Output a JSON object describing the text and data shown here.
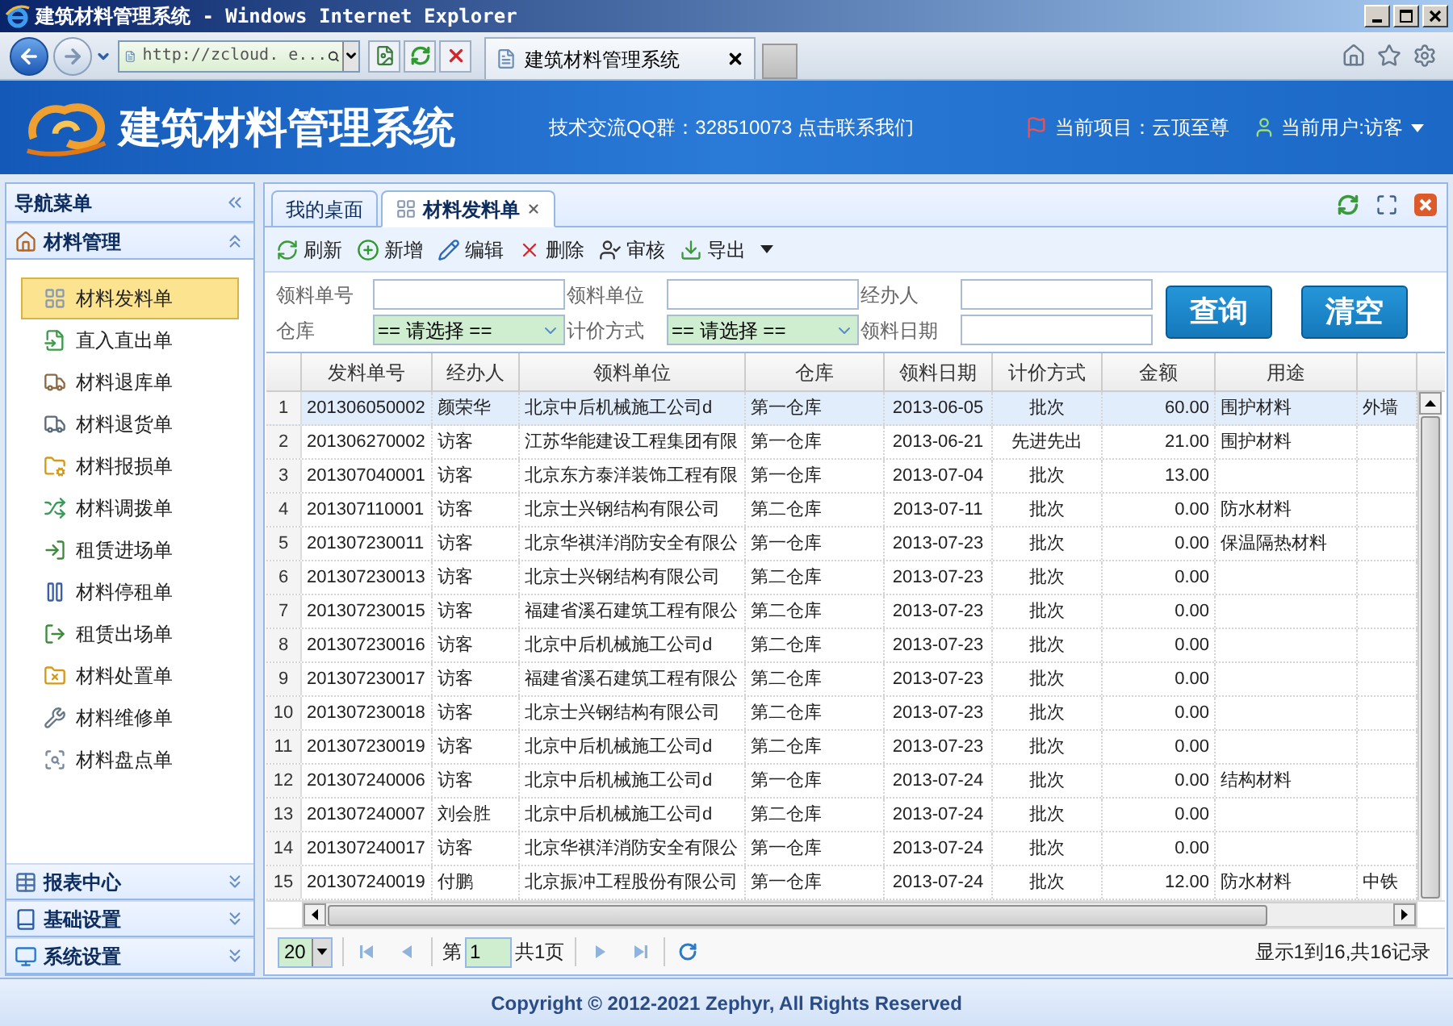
{
  "window": {
    "title": "建筑材料管理系统 - Windows Internet Explorer"
  },
  "browser": {
    "address": "http://zcloud. e...",
    "tab_title": "建筑材料管理系统"
  },
  "header": {
    "title": "建筑材料管理系统",
    "contact": "技术交流QQ群：328510073 点击联系我们",
    "project": "当前项目：云顶至尊",
    "user": "当前用户:访客"
  },
  "sidebar": {
    "title": "导航菜单",
    "sections": [
      {
        "label": "材料管理",
        "expanded": true,
        "items": [
          {
            "label": "材料发料单",
            "selected": true
          },
          {
            "label": "直入直出单",
            "selected": false
          },
          {
            "label": "材料退库单",
            "selected": false
          },
          {
            "label": "材料退货单",
            "selected": false
          },
          {
            "label": "材料报损单",
            "selected": false
          },
          {
            "label": "材料调拨单",
            "selected": false
          },
          {
            "label": "租赁进场单",
            "selected": false
          },
          {
            "label": "材料停租单",
            "selected": false
          },
          {
            "label": "租赁出场单",
            "selected": false
          },
          {
            "label": "材料处置单",
            "selected": false
          },
          {
            "label": "材料维修单",
            "selected": false
          },
          {
            "label": "材料盘点单",
            "selected": false
          }
        ]
      },
      {
        "label": "报表中心",
        "expanded": false
      },
      {
        "label": "基础设置",
        "expanded": false
      },
      {
        "label": "系统设置",
        "expanded": false
      }
    ]
  },
  "tabs": [
    {
      "label": "我的桌面",
      "selected": false,
      "closable": false
    },
    {
      "label": "材料发料单",
      "selected": true,
      "closable": true
    }
  ],
  "toolbar": [
    {
      "label": "刷新",
      "dropdown": false
    },
    {
      "label": "新增",
      "dropdown": false
    },
    {
      "label": "编辑",
      "dropdown": false
    },
    {
      "label": "删除",
      "dropdown": false
    },
    {
      "label": "审核",
      "dropdown": false
    },
    {
      "label": "导出",
      "dropdown": true
    }
  ],
  "search": {
    "fields": [
      {
        "label": "领料单号",
        "kind": "text"
      },
      {
        "label": "领料单位",
        "kind": "text"
      },
      {
        "label": "经办人",
        "kind": "text"
      },
      {
        "label": "仓库",
        "kind": "select",
        "value": "== 请选择 =="
      },
      {
        "label": "计价方式",
        "kind": "select",
        "value": "== 请选择 =="
      },
      {
        "label": "领料日期",
        "kind": "text"
      }
    ],
    "buttons": [
      "查询",
      "清空"
    ]
  },
  "table": {
    "columns": [
      "发料单号",
      "经办人",
      "领料单位",
      "仓库",
      "领料日期",
      "计价方式",
      "金额",
      "用途"
    ],
    "rows": [
      {
        "no": "1",
        "selected": true,
        "order_no": "201306050002",
        "handler": "颜荣华",
        "unit": "北京中后机械施工公司d",
        "warehouse": "第一仓库",
        "date": "2013-06-05",
        "pricing": "批次",
        "amount": "60.00",
        "purpose": "围护材料",
        "column_10": "外墙"
      },
      {
        "no": "2",
        "selected": false,
        "order_no": "201306270002",
        "handler": "访客",
        "unit": "江苏华能建设工程集团有限",
        "warehouse": "第一仓库",
        "date": "2013-06-21",
        "pricing": "先进先出",
        "amount": "21.00",
        "purpose": "围护材料"
      },
      {
        "no": "3",
        "selected": false,
        "order_no": "201307040001",
        "handler": "访客",
        "unit": "北京东方泰洋装饰工程有限",
        "warehouse": "第一仓库",
        "date": "2013-07-04",
        "pricing": "批次",
        "amount": "13.00"
      },
      {
        "no": "4",
        "selected": false,
        "order_no": "201307110001",
        "handler": "访客",
        "unit": "北京士兴钢结构有限公司",
        "warehouse": "第二仓库",
        "date": "2013-07-11",
        "pricing": "批次",
        "amount": "0.00",
        "purpose": "防水材料"
      },
      {
        "no": "5",
        "selected": false,
        "order_no": "201307230011",
        "handler": "访客",
        "unit": "北京华祺洋消防安全有限公",
        "warehouse": "第一仓库",
        "date": "2013-07-23",
        "pricing": "批次",
        "amount": "0.00",
        "purpose": "保温隔热材料"
      },
      {
        "no": "6",
        "selected": false,
        "order_no": "201307230013",
        "handler": "访客",
        "unit": "北京士兴钢结构有限公司",
        "warehouse": "第二仓库",
        "date": "2013-07-23",
        "pricing": "批次",
        "amount": "0.00"
      },
      {
        "no": "7",
        "selected": false,
        "order_no": "201307230015",
        "handler": "访客",
        "unit": "福建省溪石建筑工程有限公",
        "warehouse": "第二仓库",
        "date": "2013-07-23",
        "pricing": "批次",
        "amount": "0.00"
      },
      {
        "no": "8",
        "selected": false,
        "order_no": "201307230016",
        "handler": "访客",
        "unit": "北京中后机械施工公司d",
        "warehouse": "第二仓库",
        "date": "2013-07-23",
        "pricing": "批次",
        "amount": "0.00"
      },
      {
        "no": "9",
        "selected": false,
        "order_no": "201307230017",
        "handler": "访客",
        "unit": "福建省溪石建筑工程有限公",
        "warehouse": "第二仓库",
        "date": "2013-07-23",
        "pricing": "批次",
        "amount": "0.00"
      },
      {
        "no": "10",
        "selected": false,
        "order_no": "201307230018",
        "handler": "访客",
        "unit": "北京士兴钢结构有限公司",
        "warehouse": "第二仓库",
        "date": "2013-07-23",
        "pricing": "批次",
        "amount": "0.00"
      },
      {
        "no": "11",
        "selected": false,
        "order_no": "201307230019",
        "handler": "访客",
        "unit": "北京中后机械施工公司d",
        "warehouse": "第二仓库",
        "date": "2013-07-23",
        "pricing": "批次",
        "amount": "0.00"
      },
      {
        "no": "12",
        "selected": false,
        "order_no": "201307240006",
        "handler": "访客",
        "unit": "北京中后机械施工公司d",
        "warehouse": "第一仓库",
        "date": "2013-07-24",
        "pricing": "批次",
        "amount": "0.00",
        "purpose": "结构材料"
      },
      {
        "no": "13",
        "selected": false,
        "order_no": "201307240007",
        "handler": "刘会胜",
        "unit": "北京中后机械施工公司d",
        "warehouse": "第二仓库",
        "date": "2013-07-24",
        "pricing": "批次",
        "amount": "0.00"
      },
      {
        "no": "14",
        "selected": false,
        "order_no": "201307240017",
        "handler": "访客",
        "unit": "北京华祺洋消防安全有限公",
        "warehouse": "第一仓库",
        "date": "2013-07-24",
        "pricing": "批次",
        "amount": "0.00"
      },
      {
        "no": "15",
        "selected": false,
        "order_no": "201307240019",
        "handler": "付鹏",
        "unit": "北京振冲工程股份有限公司",
        "warehouse": "第一仓库",
        "date": "2013-07-24",
        "pricing": "批次",
        "amount": "12.00",
        "purpose": "防水材料",
        "column_10": "中铁"
      }
    ]
  },
  "pagination": {
    "page_size": "20",
    "page_prefix": "第",
    "page": "1",
    "page_total": "共1页",
    "summary": "显示1到16,共16记录"
  },
  "footer": {
    "copyright": "Copyright © 2012-2021 Zephyr, All Rights Reserved"
  }
}
